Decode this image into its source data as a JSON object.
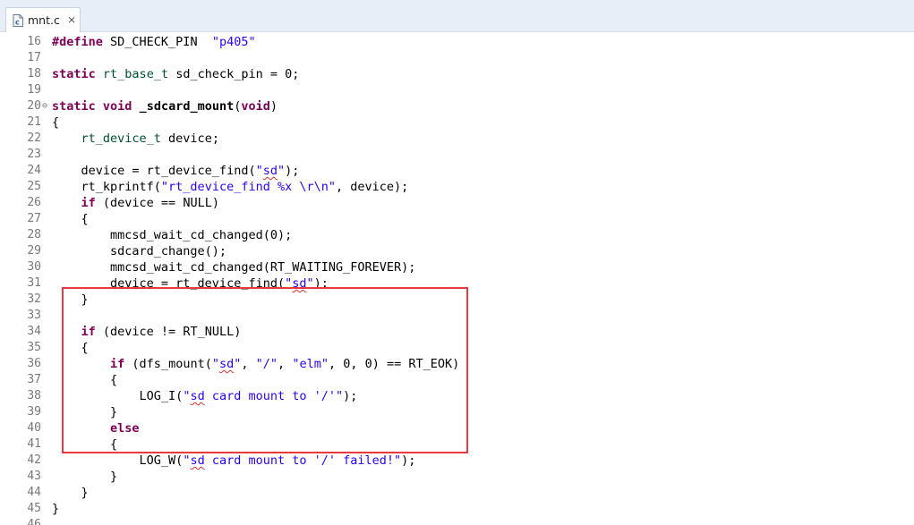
{
  "tab": {
    "label": "mnt.c",
    "file_icon": "c-source-file-icon",
    "close_icon": "close-x-icon"
  },
  "fold_marker": "⊖",
  "lines": [
    {
      "n": "16"
    },
    {
      "n": "17"
    },
    {
      "n": "18"
    },
    {
      "n": "19"
    },
    {
      "n": "20"
    },
    {
      "n": "21"
    },
    {
      "n": "22"
    },
    {
      "n": "23"
    },
    {
      "n": "24"
    },
    {
      "n": "25"
    },
    {
      "n": "26"
    },
    {
      "n": "27"
    },
    {
      "n": "28"
    },
    {
      "n": "29"
    },
    {
      "n": "30"
    },
    {
      "n": "31"
    },
    {
      "n": "32"
    },
    {
      "n": "33"
    },
    {
      "n": "34"
    },
    {
      "n": "35"
    },
    {
      "n": "36"
    },
    {
      "n": "37"
    },
    {
      "n": "38"
    },
    {
      "n": "39"
    },
    {
      "n": "40"
    },
    {
      "n": "41"
    },
    {
      "n": "42"
    },
    {
      "n": "43"
    },
    {
      "n": "44"
    },
    {
      "n": "45"
    },
    {
      "n": "46"
    }
  ],
  "code": {
    "l16": {
      "a": "#define",
      "b": " SD_CHECK_PIN  ",
      "c": "\"p405\""
    },
    "l18": {
      "a": "static",
      "b": " ",
      "c": "rt_base_t",
      "d": " sd_check_pin = 0;"
    },
    "l20": {
      "a": "static",
      "b": " ",
      "c": "void",
      "d": " ",
      "e": "_sdcard_mount",
      "f": "(",
      "g": "void",
      "h": ")"
    },
    "l21": {
      "a": "{"
    },
    "l22": {
      "a": "    ",
      "b": "rt_device_t",
      "c": " device;"
    },
    "l24": {
      "a": "    device = rt_device_find(",
      "b": "\"",
      "c": "sd",
      "d": "\"",
      "e": ");"
    },
    "l25": {
      "a": "    rt_kprintf(",
      "b": "\"rt_device_find %x \\r\\n\"",
      "c": ", device);"
    },
    "l26": {
      "a": "    ",
      "b": "if",
      "c": " (device == NULL)"
    },
    "l27": {
      "a": "    {"
    },
    "l28": {
      "a": "        mmcsd_wait_cd_changed(0);"
    },
    "l29": {
      "a": "        sdcard_change();"
    },
    "l30": {
      "a": "        mmcsd_wait_cd_changed(RT_WAITING_FOREVER);"
    },
    "l31": {
      "a": "        device = rt_device_find(",
      "b": "\"",
      "c": "sd",
      "d": "\"",
      "e": ");"
    },
    "l32": {
      "a": "    }"
    },
    "l34": {
      "a": "    ",
      "b": "if",
      "c": " (device != RT_NULL)"
    },
    "l35": {
      "a": "    {"
    },
    "l36": {
      "a": "        ",
      "b": "if",
      "c": " (dfs_mount(",
      "d": "\"",
      "e": "sd",
      "f": "\"",
      "g": ", ",
      "h": "\"/\"",
      "i": ", ",
      "j": "\"elm\"",
      "k": ", 0, 0) == RT_EOK)"
    },
    "l37": {
      "a": "        {"
    },
    "l38": {
      "a": "            LOG_I(",
      "b": "\"",
      "c": "sd",
      "d": " card mount to '/'\"",
      "e": ");"
    },
    "l39": {
      "a": "        }"
    },
    "l40": {
      "a": "        ",
      "b": "else"
    },
    "l41": {
      "a": "        {"
    },
    "l42": {
      "a": "            LOG_W(",
      "b": "\"",
      "c": "sd",
      "d": " card mount to '/' failed!\"",
      "e": ");"
    },
    "l43": {
      "a": "        }"
    },
    "l44": {
      "a": "    }"
    },
    "l45": {
      "a": "}"
    }
  },
  "colors": {
    "keyword": "#7f0055",
    "type": "#005032",
    "string": "#2a00ff",
    "highlight_box": "#e8393d"
  }
}
